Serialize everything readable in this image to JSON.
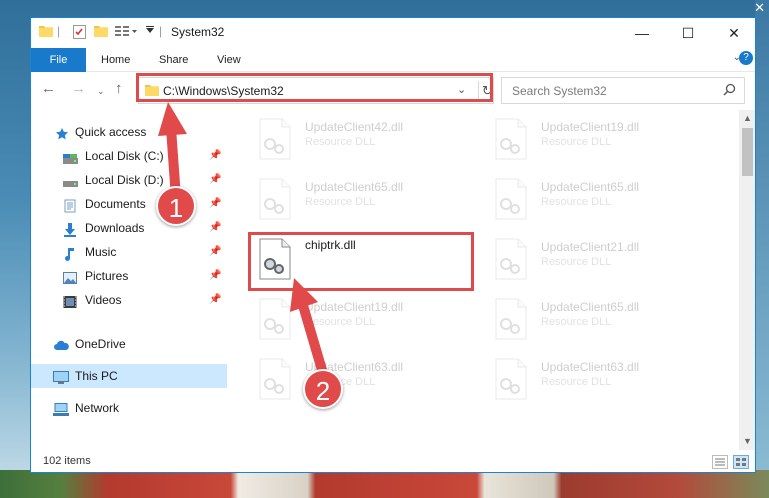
{
  "window": {
    "title": "System32"
  },
  "ribbon": {
    "tabs": [
      "File",
      "Home",
      "Share",
      "View"
    ]
  },
  "navbar": {
    "address": "C:\\Windows\\System32",
    "search_placeholder": "Search System32"
  },
  "sidebar": {
    "items": [
      {
        "label": "Quick access",
        "icon": "star-icon",
        "pinned": false
      },
      {
        "label": "Local Disk (C:)",
        "icon": "drive-icon",
        "pinned": true
      },
      {
        "label": "Local Disk (D:)",
        "icon": "drive-icon",
        "pinned": true
      },
      {
        "label": "Documents",
        "icon": "documents-icon",
        "pinned": true
      },
      {
        "label": "Downloads",
        "icon": "download-icon",
        "pinned": true
      },
      {
        "label": "Music",
        "icon": "music-icon",
        "pinned": true
      },
      {
        "label": "Pictures",
        "icon": "pictures-icon",
        "pinned": true
      },
      {
        "label": "Videos",
        "icon": "videos-icon",
        "pinned": true
      },
      {
        "label": "OneDrive",
        "icon": "cloud-icon",
        "pinned": false
      },
      {
        "label": "This PC",
        "icon": "computer-icon",
        "pinned": false
      },
      {
        "label": "Network",
        "icon": "network-icon",
        "pinned": false
      }
    ]
  },
  "files": [
    {
      "name": "UpdateClient42.dll",
      "type": "Resource DLL"
    },
    {
      "name": "UpdateClient19.dll",
      "type": "Resource DLL"
    },
    {
      "name": "UpdateClient65.dll",
      "type": "Resource DLL"
    },
    {
      "name": "UpdateClient65.dll",
      "type": "Resource DLL"
    },
    {
      "name": "chiptrk.dll",
      "type": ""
    },
    {
      "name": "UpdateClient21.dll",
      "type": "Resource DLL"
    },
    {
      "name": "UpdateClient19.dll",
      "type": "Resource DLL"
    },
    {
      "name": "UpdateClient65.dll",
      "type": "Resource DLL"
    },
    {
      "name": "UpdateClient63.dll",
      "type": "Resource DLL"
    },
    {
      "name": "UpdateClient63.dll",
      "type": "Resource DLL"
    }
  ],
  "status": {
    "item_count": "102 items"
  },
  "annotations": {
    "step1": "1",
    "step2": "2"
  },
  "colors": {
    "accent": "#1979ca",
    "highlight": "#dd4c4c",
    "selected": "#cce8ff"
  }
}
